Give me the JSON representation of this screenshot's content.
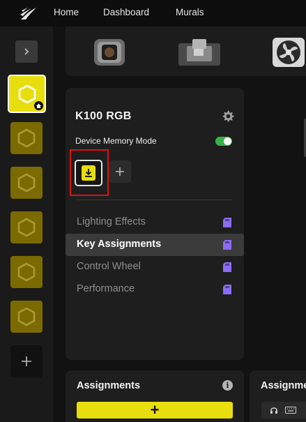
{
  "nav": {
    "logo_icon": "corsair-sails-logo",
    "items": [
      {
        "label": "Home"
      },
      {
        "label": "Dashboard"
      },
      {
        "label": "Murals"
      }
    ]
  },
  "sidebar": {
    "toggle_icon": "chevron-right-icon",
    "devices": [
      {
        "icon": "hexagon-device-icon",
        "active": true,
        "badge_icon": "home-icon"
      },
      {
        "icon": "hexagon-device-icon",
        "active": false
      },
      {
        "icon": "hexagon-device-icon",
        "active": false
      },
      {
        "icon": "hexagon-device-icon",
        "active": false
      },
      {
        "icon": "hexagon-device-icon",
        "active": false
      },
      {
        "icon": "hexagon-device-icon",
        "active": false
      }
    ],
    "add_icon": "plus-icon"
  },
  "device_strip": [
    {
      "icon": "pump-head-icon"
    },
    {
      "icon": "gpu-waterblock-icon"
    },
    {
      "icon": "fan-icon"
    }
  ],
  "device_panel": {
    "title": "K100 RGB",
    "settings_icon": "gear-icon",
    "memory_mode_label": "Device Memory Mode",
    "memory_mode_on": true,
    "profile_icon": "download-profile-icon",
    "add_profile_icon": "plus-icon",
    "menu": [
      {
        "label": "Lighting Effects",
        "active": false,
        "icon": "memory-card-icon"
      },
      {
        "label": "Key Assignments",
        "active": true,
        "icon": "memory-card-icon"
      },
      {
        "label": "Control Wheel",
        "active": false,
        "icon": "memory-card-icon"
      },
      {
        "label": "Performance",
        "active": false,
        "icon": "memory-card-icon"
      }
    ]
  },
  "assignments": {
    "title": "Assignments",
    "info_icon": "info-icon",
    "add_label": "+"
  },
  "assignments_right": {
    "title": "Assignme"
  },
  "colors": {
    "accent": "#e8de0e",
    "accent_dim": "#7a6a00",
    "highlight_border": "#e01010",
    "toggle_on": "#36b34a",
    "memory_icon": "#8b6cf2"
  }
}
